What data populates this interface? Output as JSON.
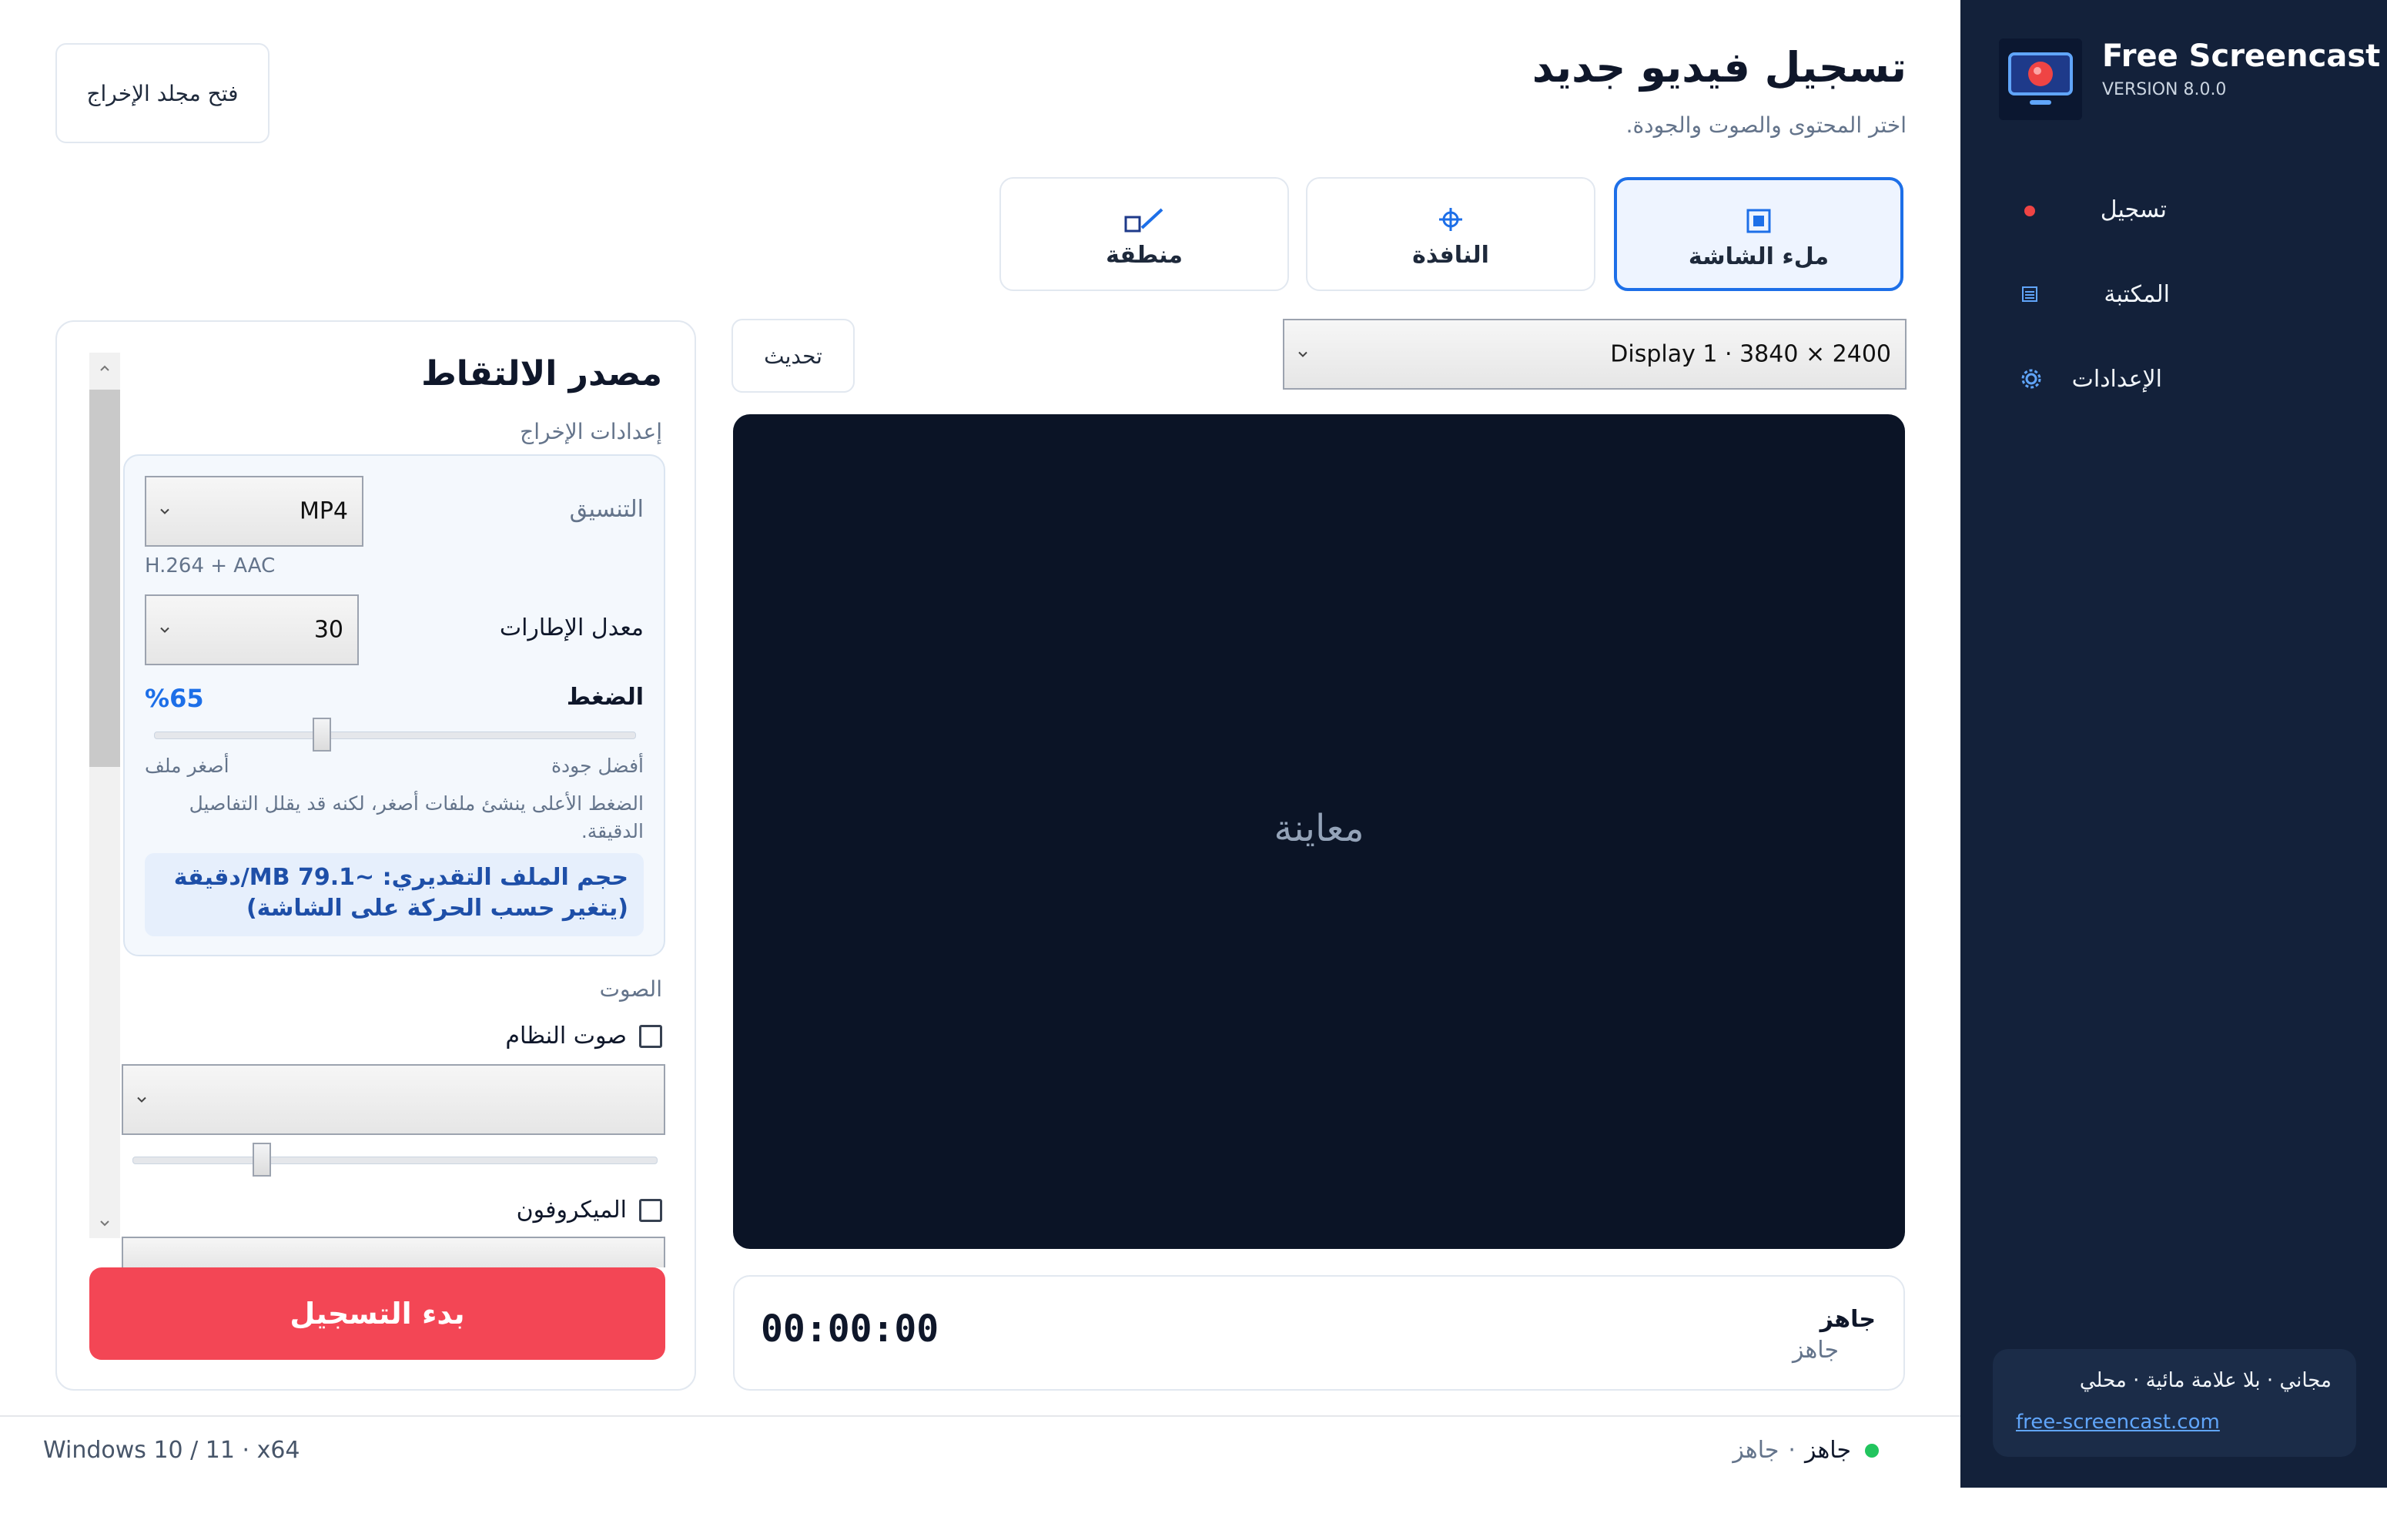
{
  "sidebar": {
    "app_name": "Free Screencast",
    "version": "VERSION 8.0.0",
    "items": [
      {
        "label": "تسجيل",
        "icon": "record-dot-icon"
      },
      {
        "label": "المكتبة",
        "icon": "library-icon"
      },
      {
        "label": "الإعدادات",
        "icon": "settings-gear-icon"
      }
    ],
    "card_line1": "مجاني · بلا علامة مائية · محلي",
    "card_link": "free-screencast.com"
  },
  "header": {
    "title": "تسجيل فيديو جديد",
    "subtitle": "اختر المحتوى والصوت والجودة.",
    "open_folder_button": "فتح مجلد الإخراج"
  },
  "modes": {
    "fullscreen": "ملء الشاشة",
    "window": "النافذة",
    "region": "منطقة",
    "active": "fullscreen"
  },
  "display_select": {
    "value": "Display 1  ·  3840 × 2400"
  },
  "refresh_button": "تحديث",
  "preview_label": "معاينة",
  "status": {
    "timer": "00:00:00",
    "state_title": "جاهز",
    "state_sub": "جاهز"
  },
  "panel": {
    "title": "مصدر الالتقاط",
    "output_section": "إعدادات الإخراج",
    "format_label": "التنسيق",
    "format_value": "MP4",
    "codec": "H.264 + AAC",
    "fps_label": "معدل الإطارات",
    "fps_value": "30",
    "compression_label": "الضغط",
    "compression_percent_text": "%65",
    "compression_value": 0.35,
    "best_quality": "أفضل جودة",
    "smaller_file": "أصغر ملف",
    "hint": "الضغط الأعلى ينشئ ملفات أصغر، لكنه قد يقلل التفاصيل الدقيقة.",
    "estimate": "حجم الملف التقديري: ~79.1 MB/دقيقة (يتغير حسب الحركة على الشاشة)",
    "audio_section": "الصوت",
    "system_audio": "صوت النظام",
    "microphone": "الميكروفون",
    "start_button": "بدء التسجيل"
  },
  "footer": {
    "platform": "Windows 10 / 11  ·  x64",
    "ready_main": "جاهز",
    "ready_sub": "جاهز"
  },
  "colors": {
    "accent": "#1d6fe8",
    "record": "#f34655",
    "sidebar": "#13213a"
  }
}
